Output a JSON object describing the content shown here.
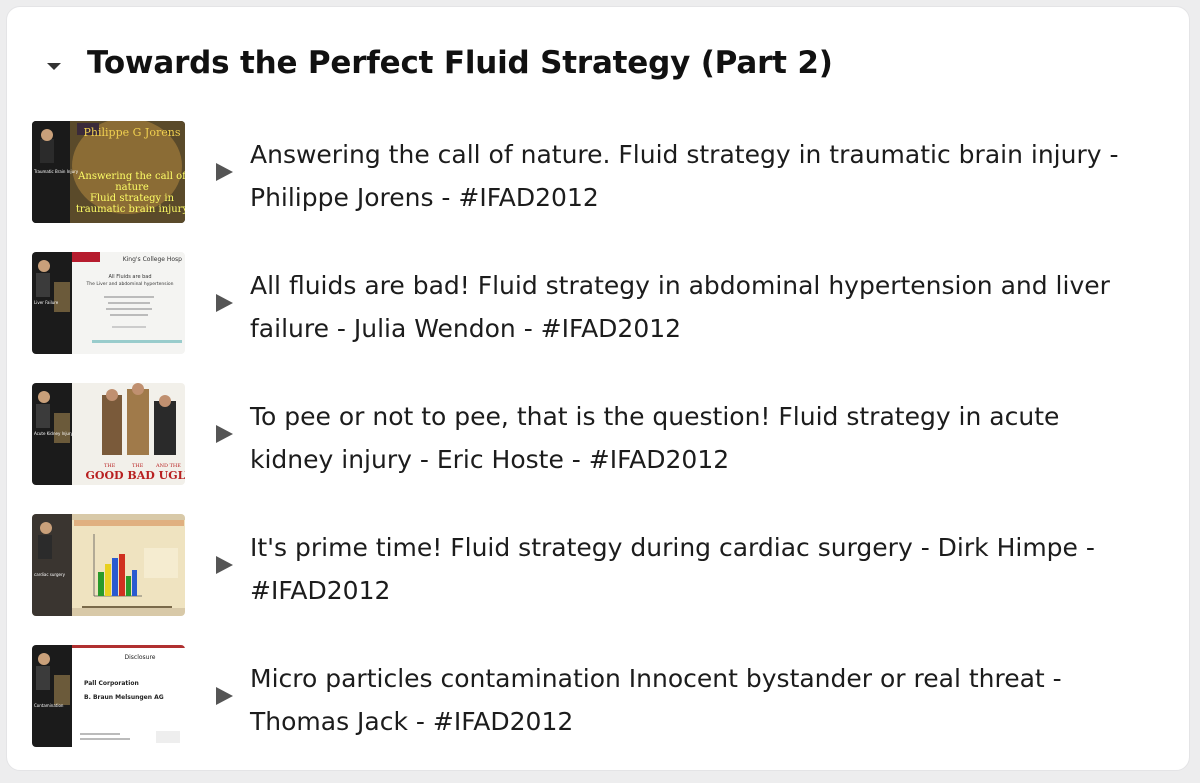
{
  "section": {
    "title": "Towards the Perfect Fluid Strategy (Part 2)"
  },
  "videos": [
    {
      "title": "Answering the call of nature. Fluid strategy in traumatic brain injury - Philippe Jorens - #IFAD2012",
      "thumbnail": {
        "speaker": "Philippe G Jorens",
        "line1": "Answering the call of",
        "line2": "nature",
        "line3": "Fluid strategy in",
        "line4": "traumatic brain injury",
        "side": "Traumatic Brain Injury"
      }
    },
    {
      "title": "All fluids are bad! Fluid strategy in abdominal hypertension and liver failure - Julia Wendon - #IFAD2012",
      "thumbnail": {
        "header": "King's College Hosp",
        "line1": "All Fluids are bad",
        "line2": "The Liver and abdominal hypertension",
        "side": "Liver Failure"
      }
    },
    {
      "title": "To pee or not to pee, that is the question! Fluid strategy in acute kidney injury - Eric Hoste - #IFAD2012",
      "thumbnail": {
        "line1": "THE",
        "line2": "THE",
        "line3": "AND THE",
        "line4": "GOOD BAD UGLY",
        "side": "Acute Kidney Injury"
      }
    },
    {
      "title": "It's prime time! Fluid strategy during cardiac surgery - Dirk Himpe - #IFAD2012",
      "thumbnail": {
        "side": "cardiac surgery"
      }
    },
    {
      "title": "Micro particles contamination Innocent bystander or real threat - Thomas Jack - #IFAD2012",
      "thumbnail": {
        "header": "Disclosure",
        "line1": "Pall Corporation",
        "line2": "B. Braun Melsungen AG",
        "side": "Contamination"
      }
    }
  ]
}
